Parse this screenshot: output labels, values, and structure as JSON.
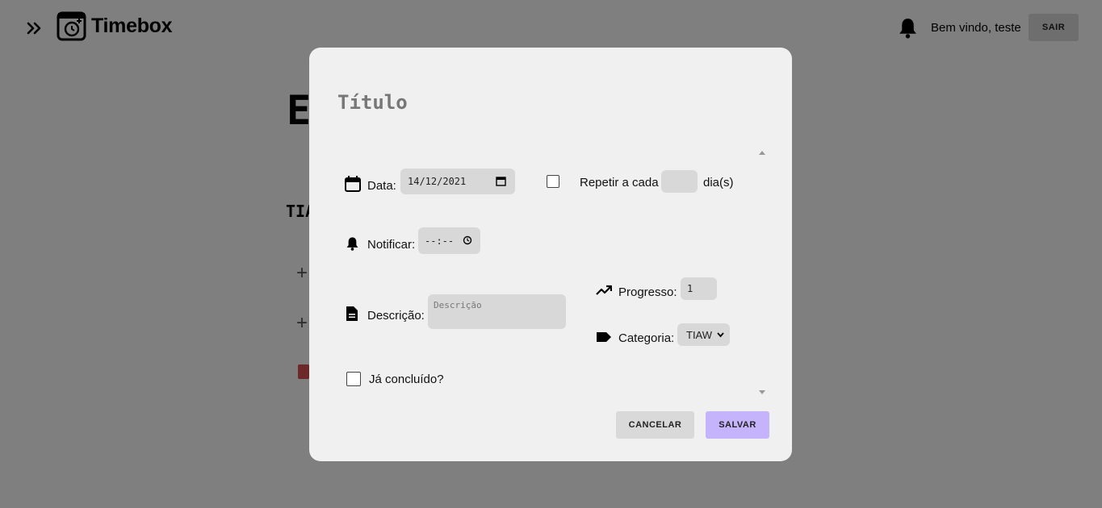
{
  "header": {
    "brand": "Timebox",
    "welcome": "Bem vindo, teste",
    "logout_label": "SAIR"
  },
  "background": {
    "heading": "E",
    "sub_heading": "TIA",
    "plus_1": "+",
    "plus_2": "+"
  },
  "modal": {
    "title_placeholder": "Título",
    "date": {
      "label": "Data:",
      "value": "14/12/2021"
    },
    "repeat": {
      "label": "Repetir a cada",
      "value": "",
      "unit": "dia(s)",
      "checked": false
    },
    "notify": {
      "label": "Notificar:",
      "value": "--:--"
    },
    "description": {
      "label": "Descrição:",
      "placeholder": "Descrição"
    },
    "progress": {
      "label": "Progresso:",
      "value": "1"
    },
    "category": {
      "label": "Categoria:",
      "selected": "TIAW"
    },
    "done": {
      "label": "Já concluído?",
      "checked": false
    },
    "cancel_label": "CANCELAR",
    "save_label": "SALVAR"
  },
  "colors": {
    "save_button": "#c5b3fb",
    "cancel_button": "#d9d9d9",
    "modal_bg": "#f0f0f0",
    "field_bg": "#d8d8d8",
    "trash": "#d9534f"
  },
  "icons": {
    "expand": "double-chevron-right-icon",
    "logo": "calendar-clock-icon",
    "bell": "bell-icon",
    "calendar": "calendar-icon",
    "notify": "bell-icon",
    "description": "document-icon",
    "progress": "trending-up-icon",
    "category": "tag-icon"
  }
}
